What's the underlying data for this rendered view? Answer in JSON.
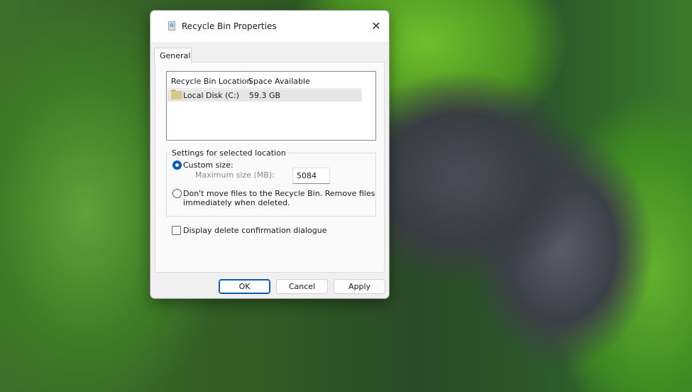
{
  "window": {
    "title": "Recycle Bin Properties",
    "close_label": "✕"
  },
  "tabs": [
    {
      "label": "General"
    }
  ],
  "list": {
    "columns": [
      "Recycle Bin Location",
      "Space Available"
    ],
    "rows": [
      {
        "location": "Local Disk  (C:)",
        "space": "59.3 GB"
      }
    ]
  },
  "settings": {
    "group_label": "Settings for selected location",
    "custom_size_label": "Custom size:",
    "custom_size_checked": true,
    "max_size_label": "Maximum size (MB):",
    "max_size_value": "5084",
    "dont_move_line1": "Don't move files to the Recycle Bin. Remove files",
    "dont_move_line2": "immediately when deleted.",
    "dont_move_checked": false
  },
  "confirm": {
    "label": "Display delete confirmation dialogue",
    "checked": false
  },
  "buttons": {
    "ok": "OK",
    "cancel": "Cancel",
    "apply": "Apply"
  },
  "colors": {
    "accent": "#0a5fb4"
  }
}
